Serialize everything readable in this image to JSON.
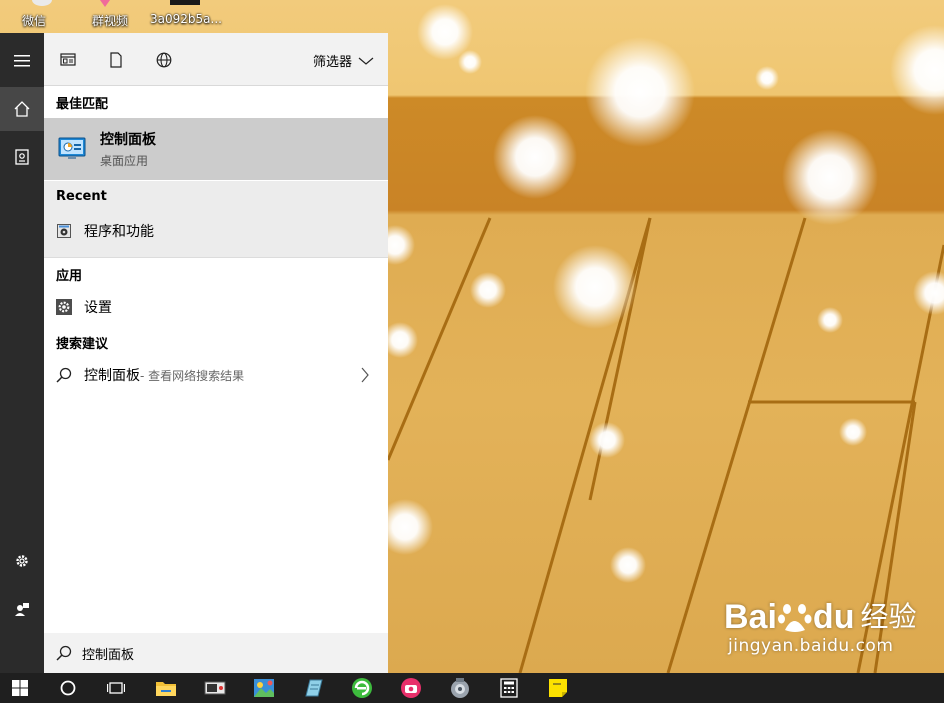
{
  "desktop": {
    "icons": [
      {
        "label": "微信"
      },
      {
        "label": "群视频"
      },
      {
        "label": "3a092b5a..."
      }
    ]
  },
  "panel": {
    "filter_label": "筛选器",
    "sections": {
      "best_match": "最佳匹配",
      "recent": "Recent",
      "apps": "应用",
      "suggestions": "搜索建议"
    },
    "best_item": {
      "title": "控制面板",
      "subtitle": "桌面应用",
      "icon": "control-panel-icon"
    },
    "recent_item": {
      "label": "程序和功能",
      "icon": "programs-features-icon"
    },
    "app_item": {
      "label": "设置",
      "icon": "gear-icon"
    },
    "suggestion": {
      "term": "控制面板",
      "suffix": " - 查看网络搜索结果"
    },
    "search_query": "控制面板"
  },
  "watermark": {
    "brand_left": "Bai",
    "brand_right": "du",
    "brand_cn": "经验",
    "url": "jingyan.baidu.com"
  },
  "colors": {
    "rail": "#2b2b2b",
    "taskbar": "#1f1f1f",
    "highlight": "#cccccc",
    "accent": "#0078d7"
  }
}
